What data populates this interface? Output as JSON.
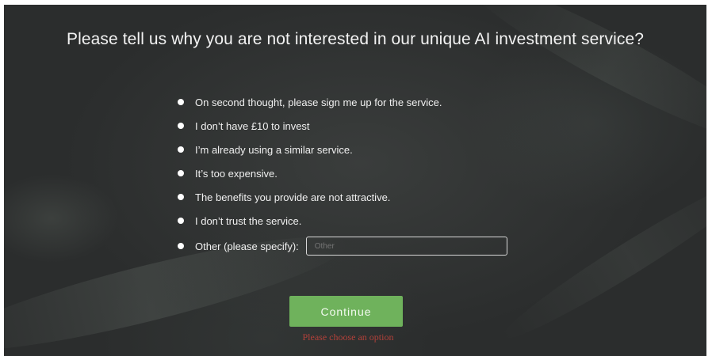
{
  "survey": {
    "question": "Please tell us why you are not interested in our unique AI investment service?",
    "options": [
      {
        "label": "On second thought, please sign me up for the service."
      },
      {
        "label": "I don’t have £10 to invest"
      },
      {
        "label": "I’m already using a similar service."
      },
      {
        "label": "It’s too expensive."
      },
      {
        "label": "The benefits you provide are not attractive."
      },
      {
        "label": "I don’t trust the service."
      },
      {
        "label": "Other (please specify):"
      }
    ],
    "other_input": {
      "placeholder": "Other"
    },
    "continue_label": "Continue",
    "error_message": "Please choose an option"
  },
  "colors": {
    "background": "#2f3231",
    "text": "#f0f0f0",
    "button": "#6fb25c",
    "error": "#b3413a"
  }
}
